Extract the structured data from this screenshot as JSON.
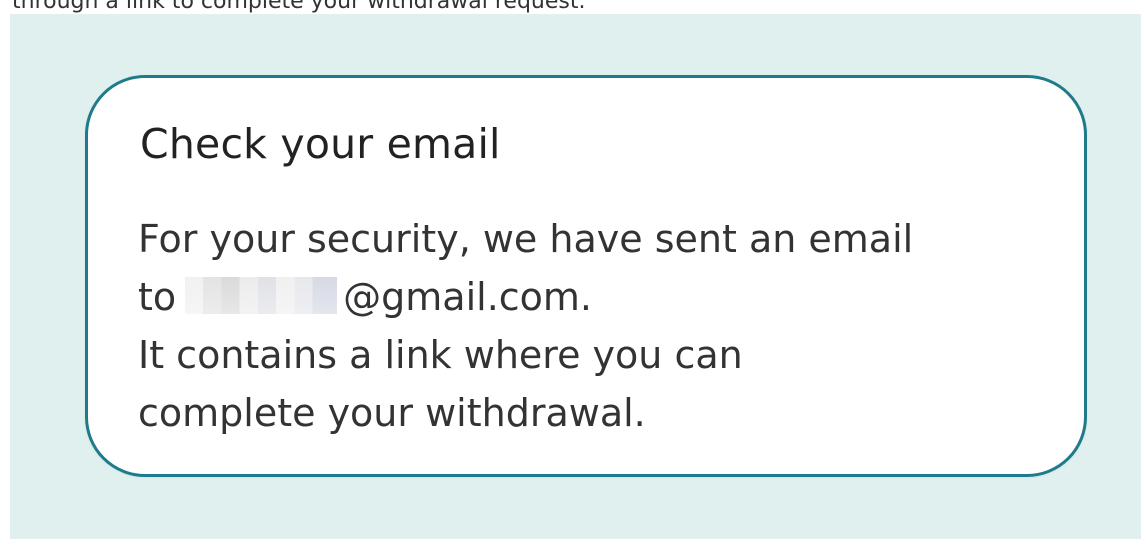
{
  "page": {
    "top_text": "through a link to complete your withdrawal request."
  },
  "notice": {
    "title": "Check your email",
    "line1": "For your security, we have sent an email",
    "line2_prefix": "to",
    "email_domain": "@gmail.com.",
    "line3": "It contains a link where you can",
    "line4": "complete your withdrawal."
  },
  "colors": {
    "panel_background": "#dff0ee",
    "card_border": "#1f7b8b",
    "card_background": "#ffffff",
    "text": "#333333"
  }
}
